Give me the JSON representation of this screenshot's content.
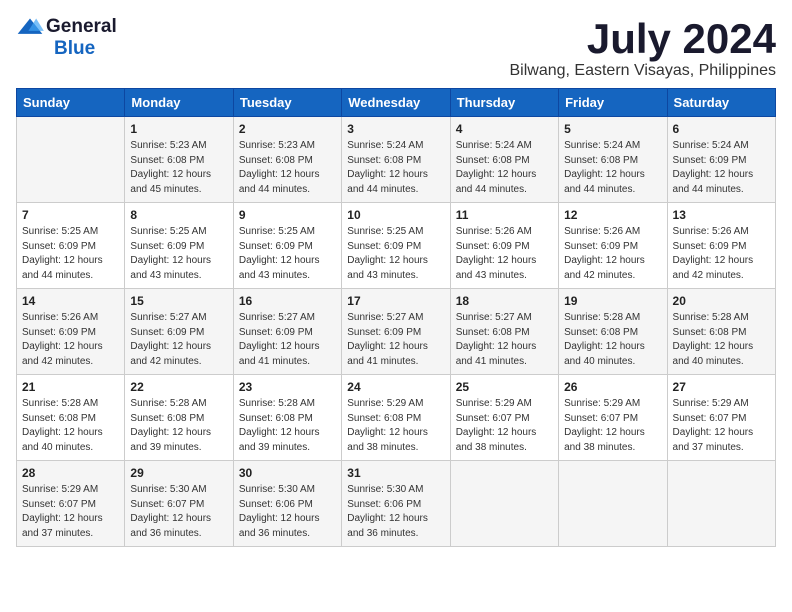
{
  "logo": {
    "general": "General",
    "blue": "Blue"
  },
  "title": "July 2024",
  "location": "Bilwang, Eastern Visayas, Philippines",
  "weekdays": [
    "Sunday",
    "Monday",
    "Tuesday",
    "Wednesday",
    "Thursday",
    "Friday",
    "Saturday"
  ],
  "weeks": [
    [
      {
        "day": "",
        "sunrise": "",
        "sunset": "",
        "daylight": ""
      },
      {
        "day": "1",
        "sunrise": "Sunrise: 5:23 AM",
        "sunset": "Sunset: 6:08 PM",
        "daylight": "Daylight: 12 hours and 45 minutes."
      },
      {
        "day": "2",
        "sunrise": "Sunrise: 5:23 AM",
        "sunset": "Sunset: 6:08 PM",
        "daylight": "Daylight: 12 hours and 44 minutes."
      },
      {
        "day": "3",
        "sunrise": "Sunrise: 5:24 AM",
        "sunset": "Sunset: 6:08 PM",
        "daylight": "Daylight: 12 hours and 44 minutes."
      },
      {
        "day": "4",
        "sunrise": "Sunrise: 5:24 AM",
        "sunset": "Sunset: 6:08 PM",
        "daylight": "Daylight: 12 hours and 44 minutes."
      },
      {
        "day": "5",
        "sunrise": "Sunrise: 5:24 AM",
        "sunset": "Sunset: 6:08 PM",
        "daylight": "Daylight: 12 hours and 44 minutes."
      },
      {
        "day": "6",
        "sunrise": "Sunrise: 5:24 AM",
        "sunset": "Sunset: 6:09 PM",
        "daylight": "Daylight: 12 hours and 44 minutes."
      }
    ],
    [
      {
        "day": "7",
        "sunrise": "Sunrise: 5:25 AM",
        "sunset": "Sunset: 6:09 PM",
        "daylight": "Daylight: 12 hours and 44 minutes."
      },
      {
        "day": "8",
        "sunrise": "Sunrise: 5:25 AM",
        "sunset": "Sunset: 6:09 PM",
        "daylight": "Daylight: 12 hours and 43 minutes."
      },
      {
        "day": "9",
        "sunrise": "Sunrise: 5:25 AM",
        "sunset": "Sunset: 6:09 PM",
        "daylight": "Daylight: 12 hours and 43 minutes."
      },
      {
        "day": "10",
        "sunrise": "Sunrise: 5:25 AM",
        "sunset": "Sunset: 6:09 PM",
        "daylight": "Daylight: 12 hours and 43 minutes."
      },
      {
        "day": "11",
        "sunrise": "Sunrise: 5:26 AM",
        "sunset": "Sunset: 6:09 PM",
        "daylight": "Daylight: 12 hours and 43 minutes."
      },
      {
        "day": "12",
        "sunrise": "Sunrise: 5:26 AM",
        "sunset": "Sunset: 6:09 PM",
        "daylight": "Daylight: 12 hours and 42 minutes."
      },
      {
        "day": "13",
        "sunrise": "Sunrise: 5:26 AM",
        "sunset": "Sunset: 6:09 PM",
        "daylight": "Daylight: 12 hours and 42 minutes."
      }
    ],
    [
      {
        "day": "14",
        "sunrise": "Sunrise: 5:26 AM",
        "sunset": "Sunset: 6:09 PM",
        "daylight": "Daylight: 12 hours and 42 minutes."
      },
      {
        "day": "15",
        "sunrise": "Sunrise: 5:27 AM",
        "sunset": "Sunset: 6:09 PM",
        "daylight": "Daylight: 12 hours and 42 minutes."
      },
      {
        "day": "16",
        "sunrise": "Sunrise: 5:27 AM",
        "sunset": "Sunset: 6:09 PM",
        "daylight": "Daylight: 12 hours and 41 minutes."
      },
      {
        "day": "17",
        "sunrise": "Sunrise: 5:27 AM",
        "sunset": "Sunset: 6:09 PM",
        "daylight": "Daylight: 12 hours and 41 minutes."
      },
      {
        "day": "18",
        "sunrise": "Sunrise: 5:27 AM",
        "sunset": "Sunset: 6:08 PM",
        "daylight": "Daylight: 12 hours and 41 minutes."
      },
      {
        "day": "19",
        "sunrise": "Sunrise: 5:28 AM",
        "sunset": "Sunset: 6:08 PM",
        "daylight": "Daylight: 12 hours and 40 minutes."
      },
      {
        "day": "20",
        "sunrise": "Sunrise: 5:28 AM",
        "sunset": "Sunset: 6:08 PM",
        "daylight": "Daylight: 12 hours and 40 minutes."
      }
    ],
    [
      {
        "day": "21",
        "sunrise": "Sunrise: 5:28 AM",
        "sunset": "Sunset: 6:08 PM",
        "daylight": "Daylight: 12 hours and 40 minutes."
      },
      {
        "day": "22",
        "sunrise": "Sunrise: 5:28 AM",
        "sunset": "Sunset: 6:08 PM",
        "daylight": "Daylight: 12 hours and 39 minutes."
      },
      {
        "day": "23",
        "sunrise": "Sunrise: 5:28 AM",
        "sunset": "Sunset: 6:08 PM",
        "daylight": "Daylight: 12 hours and 39 minutes."
      },
      {
        "day": "24",
        "sunrise": "Sunrise: 5:29 AM",
        "sunset": "Sunset: 6:08 PM",
        "daylight": "Daylight: 12 hours and 38 minutes."
      },
      {
        "day": "25",
        "sunrise": "Sunrise: 5:29 AM",
        "sunset": "Sunset: 6:07 PM",
        "daylight": "Daylight: 12 hours and 38 minutes."
      },
      {
        "day": "26",
        "sunrise": "Sunrise: 5:29 AM",
        "sunset": "Sunset: 6:07 PM",
        "daylight": "Daylight: 12 hours and 38 minutes."
      },
      {
        "day": "27",
        "sunrise": "Sunrise: 5:29 AM",
        "sunset": "Sunset: 6:07 PM",
        "daylight": "Daylight: 12 hours and 37 minutes."
      }
    ],
    [
      {
        "day": "28",
        "sunrise": "Sunrise: 5:29 AM",
        "sunset": "Sunset: 6:07 PM",
        "daylight": "Daylight: 12 hours and 37 minutes."
      },
      {
        "day": "29",
        "sunrise": "Sunrise: 5:30 AM",
        "sunset": "Sunset: 6:07 PM",
        "daylight": "Daylight: 12 hours and 36 minutes."
      },
      {
        "day": "30",
        "sunrise": "Sunrise: 5:30 AM",
        "sunset": "Sunset: 6:06 PM",
        "daylight": "Daylight: 12 hours and 36 minutes."
      },
      {
        "day": "31",
        "sunrise": "Sunrise: 5:30 AM",
        "sunset": "Sunset: 6:06 PM",
        "daylight": "Daylight: 12 hours and 36 minutes."
      },
      {
        "day": "",
        "sunrise": "",
        "sunset": "",
        "daylight": ""
      },
      {
        "day": "",
        "sunrise": "",
        "sunset": "",
        "daylight": ""
      },
      {
        "day": "",
        "sunrise": "",
        "sunset": "",
        "daylight": ""
      }
    ]
  ]
}
